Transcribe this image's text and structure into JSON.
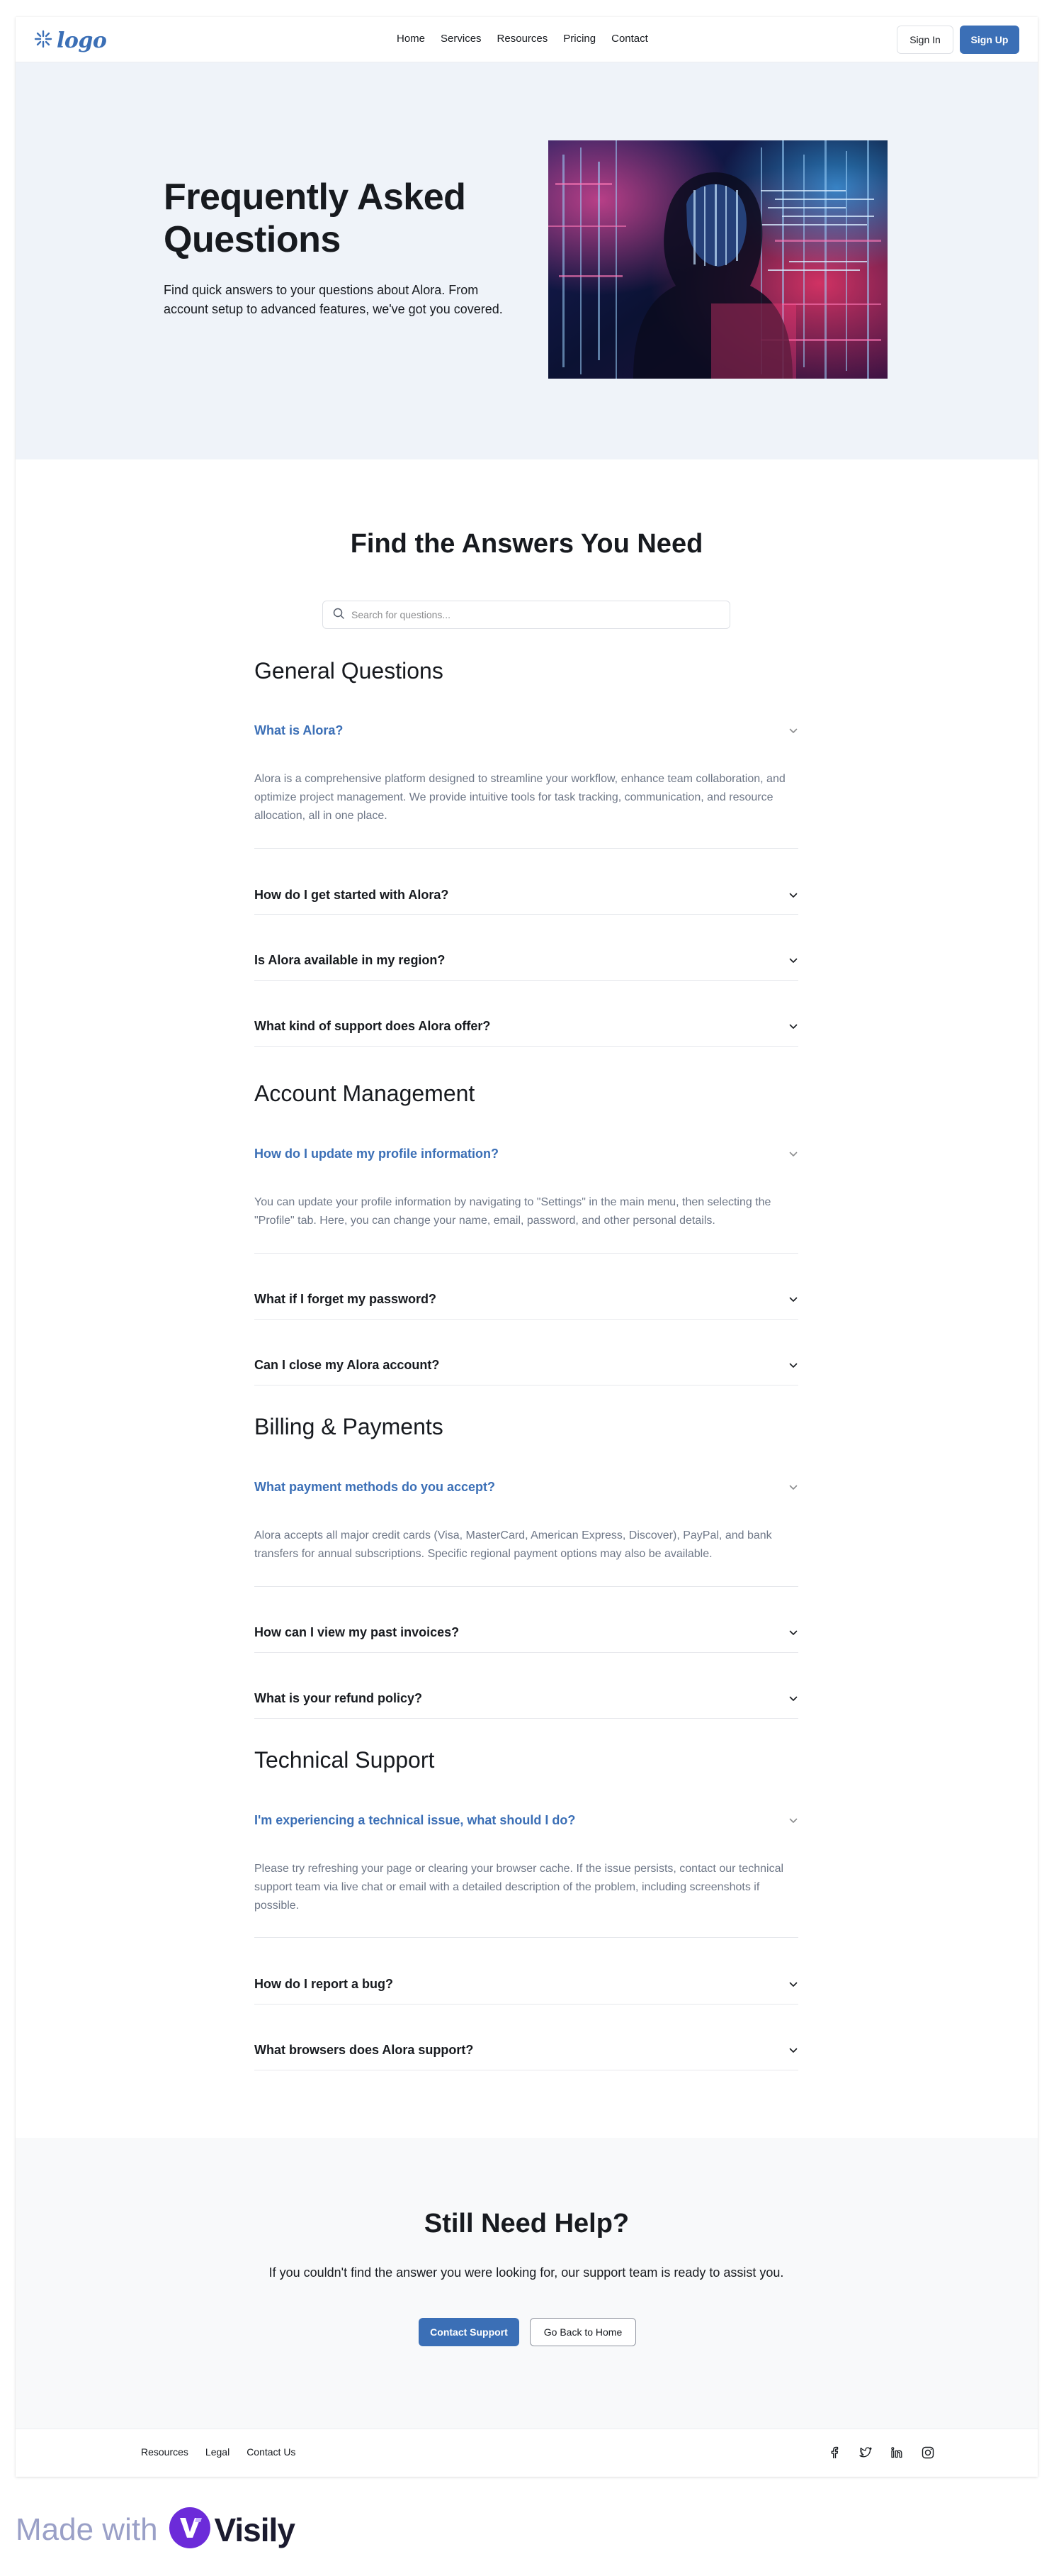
{
  "header": {
    "logo_text": "logo",
    "nav": [
      "Home",
      "Services",
      "Resources",
      "Pricing",
      "Contact"
    ],
    "sign_in": "Sign In",
    "sign_up": "Sign Up"
  },
  "hero": {
    "title": "Frequently Asked Questions",
    "subtitle": "Find quick answers to your questions about Alora. From account setup to advanced features, we've got you covered."
  },
  "faq": {
    "title": "Find the Answers You Need",
    "search_placeholder": "Search for questions...",
    "sections": [
      {
        "heading": "General Questions",
        "items": [
          {
            "q": "What is Alora?",
            "open": true,
            "a": "Alora is a comprehensive platform designed to streamline your workflow, enhance team collaboration, and optimize project management. We provide intuitive tools for task tracking, communication, and resource allocation, all in one place."
          },
          {
            "q": "How do I get started with Alora?",
            "open": false
          },
          {
            "q": "Is Alora available in my region?",
            "open": false
          },
          {
            "q": "What kind of support does Alora offer?",
            "open": false
          }
        ]
      },
      {
        "heading": "Account Management",
        "items": [
          {
            "q": "How do I update my profile information?",
            "open": true,
            "a": "You can update your profile information by navigating to \"Settings\" in the main menu, then selecting the \"Profile\" tab. Here, you can change your name, email, password, and other personal details."
          },
          {
            "q": "What if I forget my password?",
            "open": false
          },
          {
            "q": "Can I close my Alora account?",
            "open": false
          }
        ]
      },
      {
        "heading": "Billing & Payments",
        "items": [
          {
            "q": "What payment methods do you accept?",
            "open": true,
            "a": "Alora accepts all major credit cards (Visa, MasterCard, American Express, Discover), PayPal, and bank transfers for annual subscriptions. Specific regional payment options may also be available."
          },
          {
            "q": "How can I view my past invoices?",
            "open": false
          },
          {
            "q": "What is your refund policy?",
            "open": false
          }
        ]
      },
      {
        "heading": "Technical Support",
        "items": [
          {
            "q": "I'm experiencing a technical issue, what should I do?",
            "open": true,
            "a": "Please try refreshing your page or clearing your browser cache. If the issue persists, contact our technical support team via live chat or email with a detailed description of the problem, including screenshots if possible."
          },
          {
            "q": "How do I report a bug?",
            "open": false
          },
          {
            "q": "What browsers does Alora support?",
            "open": false
          }
        ]
      }
    ]
  },
  "help": {
    "title": "Still Need Help?",
    "subtitle": "If you couldn't find the answer you were looking for, our support team is ready to assist you.",
    "contact_button": "Contact Support",
    "home_button": "Go Back to Home"
  },
  "footer": {
    "links": [
      "Resources",
      "Legal",
      "Contact Us"
    ],
    "icons": [
      "facebook-icon",
      "twitter-icon",
      "linkedin-icon",
      "instagram-icon"
    ]
  },
  "made_with": {
    "text": "Made with",
    "brand": "Visily"
  },
  "colors": {
    "accent": "#3b6fb6",
    "hero_bg": "#eff3f9",
    "answer_text": "#6e7787"
  }
}
